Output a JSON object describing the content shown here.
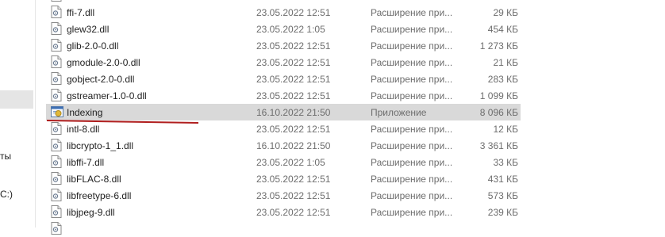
{
  "nav": {
    "label_1": "ты",
    "label_2": "C:)"
  },
  "files": [
    {
      "name": "",
      "date": "",
      "type": "",
      "size": "",
      "icon": "dll-file-icon"
    },
    {
      "name": "ffi-7.dll",
      "date": "23.05.2022 12:51",
      "type": "Расширение при...",
      "size": "29 КБ",
      "icon": "dll-file-icon"
    },
    {
      "name": "glew32.dll",
      "date": "23.05.2022 1:05",
      "type": "Расширение при...",
      "size": "454 КБ",
      "icon": "dll-file-icon"
    },
    {
      "name": "glib-2.0-0.dll",
      "date": "23.05.2022 12:51",
      "type": "Расширение при...",
      "size": "1 273 КБ",
      "icon": "dll-file-icon"
    },
    {
      "name": "gmodule-2.0-0.dll",
      "date": "23.05.2022 12:51",
      "type": "Расширение при...",
      "size": "21 КБ",
      "icon": "dll-file-icon"
    },
    {
      "name": "gobject-2.0-0.dll",
      "date": "23.05.2022 12:51",
      "type": "Расширение при...",
      "size": "283 КБ",
      "icon": "dll-file-icon"
    },
    {
      "name": "gstreamer-1.0-0.dll",
      "date": "23.05.2022 12:51",
      "type": "Расширение при...",
      "size": "1 099 КБ",
      "icon": "dll-file-icon"
    },
    {
      "name": "Indexing",
      "date": "16.10.2022 21:50",
      "type": "Приложение",
      "size": "8 096 КБ",
      "icon": "application-icon",
      "selected": true
    },
    {
      "name": "intl-8.dll",
      "date": "23.05.2022 12:51",
      "type": "Расширение при...",
      "size": "12 КБ",
      "icon": "dll-file-icon"
    },
    {
      "name": "libcrypto-1_1.dll",
      "date": "16.10.2022 21:50",
      "type": "Расширение при...",
      "size": "3 361 КБ",
      "icon": "dll-file-icon"
    },
    {
      "name": "libffi-7.dll",
      "date": "23.05.2022 1:05",
      "type": "Расширение при...",
      "size": "33 КБ",
      "icon": "dll-file-icon"
    },
    {
      "name": "libFLAC-8.dll",
      "date": "23.05.2022 12:51",
      "type": "Расширение при...",
      "size": "431 КБ",
      "icon": "dll-file-icon"
    },
    {
      "name": "libfreetype-6.dll",
      "date": "23.05.2022 12:51",
      "type": "Расширение при...",
      "size": "573 КБ",
      "icon": "dll-file-icon"
    },
    {
      "name": "libjpeg-9.dll",
      "date": "23.05.2022 12:51",
      "type": "Расширение при...",
      "size": "239 КБ",
      "icon": "dll-file-icon"
    },
    {
      "name": "",
      "date": "",
      "type": "",
      "size": "",
      "icon": "dll-file-icon"
    }
  ],
  "colors": {
    "selection": "#d9d9d9",
    "annotation_underline": "#b01e1e",
    "secondary_text": "#6d6d6d"
  }
}
